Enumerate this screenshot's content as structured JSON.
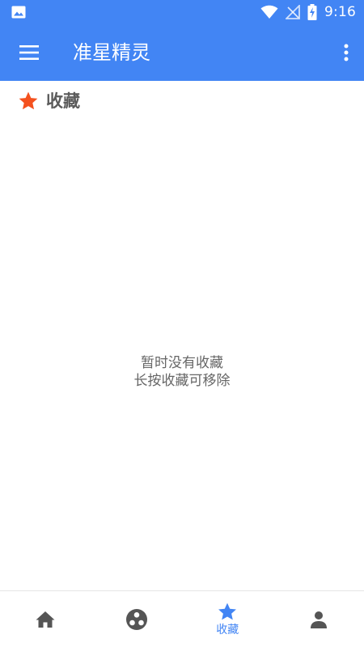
{
  "status_bar": {
    "time": "9:16",
    "icons": [
      "image-icon",
      "wifi-icon",
      "no-signal-icon",
      "battery-charging-icon"
    ]
  },
  "app_bar": {
    "title": "准星精灵",
    "menu_icon": "hamburger-menu-icon",
    "overflow_icon": "more-vert-icon"
  },
  "section": {
    "icon": "star-icon",
    "title": "收藏"
  },
  "empty_state": {
    "line1": "暂时没有收藏",
    "line2": "长按收藏可移除"
  },
  "bottom_nav": {
    "items": [
      {
        "icon": "home-icon",
        "label": "",
        "active": false
      },
      {
        "icon": "crosshair-icon",
        "label": "",
        "active": false
      },
      {
        "icon": "star-icon",
        "label": "收藏",
        "active": true
      },
      {
        "icon": "person-icon",
        "label": "",
        "active": false
      }
    ]
  },
  "colors": {
    "primary": "#4285f4",
    "accent_star": "#f4511e",
    "inactive_icon": "#555555"
  }
}
